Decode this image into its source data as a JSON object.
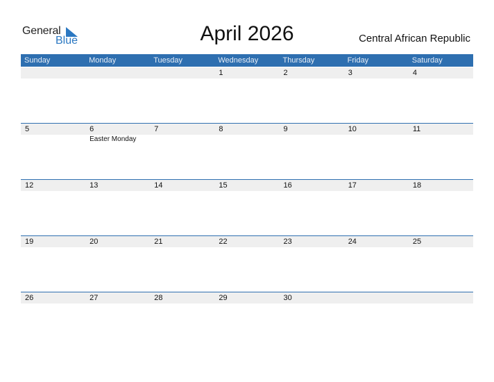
{
  "logo": {
    "general": "General",
    "blue": "Blue"
  },
  "title": "April 2026",
  "country": "Central African Republic",
  "colors": {
    "accent": "#2e6fb0",
    "strip": "#efefef",
    "logo_blue": "#2b78c2"
  },
  "weekdays": [
    "Sunday",
    "Monday",
    "Tuesday",
    "Wednesday",
    "Thursday",
    "Friday",
    "Saturday"
  ],
  "weeks": [
    [
      {
        "d": ""
      },
      {
        "d": ""
      },
      {
        "d": ""
      },
      {
        "d": "1"
      },
      {
        "d": "2"
      },
      {
        "d": "3"
      },
      {
        "d": "4"
      }
    ],
    [
      {
        "d": "5"
      },
      {
        "d": "6",
        "event": "Easter Monday"
      },
      {
        "d": "7"
      },
      {
        "d": "8"
      },
      {
        "d": "9"
      },
      {
        "d": "10"
      },
      {
        "d": "11"
      }
    ],
    [
      {
        "d": "12"
      },
      {
        "d": "13"
      },
      {
        "d": "14"
      },
      {
        "d": "15"
      },
      {
        "d": "16"
      },
      {
        "d": "17"
      },
      {
        "d": "18"
      }
    ],
    [
      {
        "d": "19"
      },
      {
        "d": "20"
      },
      {
        "d": "21"
      },
      {
        "d": "22"
      },
      {
        "d": "23"
      },
      {
        "d": "24"
      },
      {
        "d": "25"
      }
    ],
    [
      {
        "d": "26"
      },
      {
        "d": "27"
      },
      {
        "d": "28"
      },
      {
        "d": "29"
      },
      {
        "d": "30"
      },
      {
        "d": ""
      },
      {
        "d": ""
      }
    ]
  ]
}
